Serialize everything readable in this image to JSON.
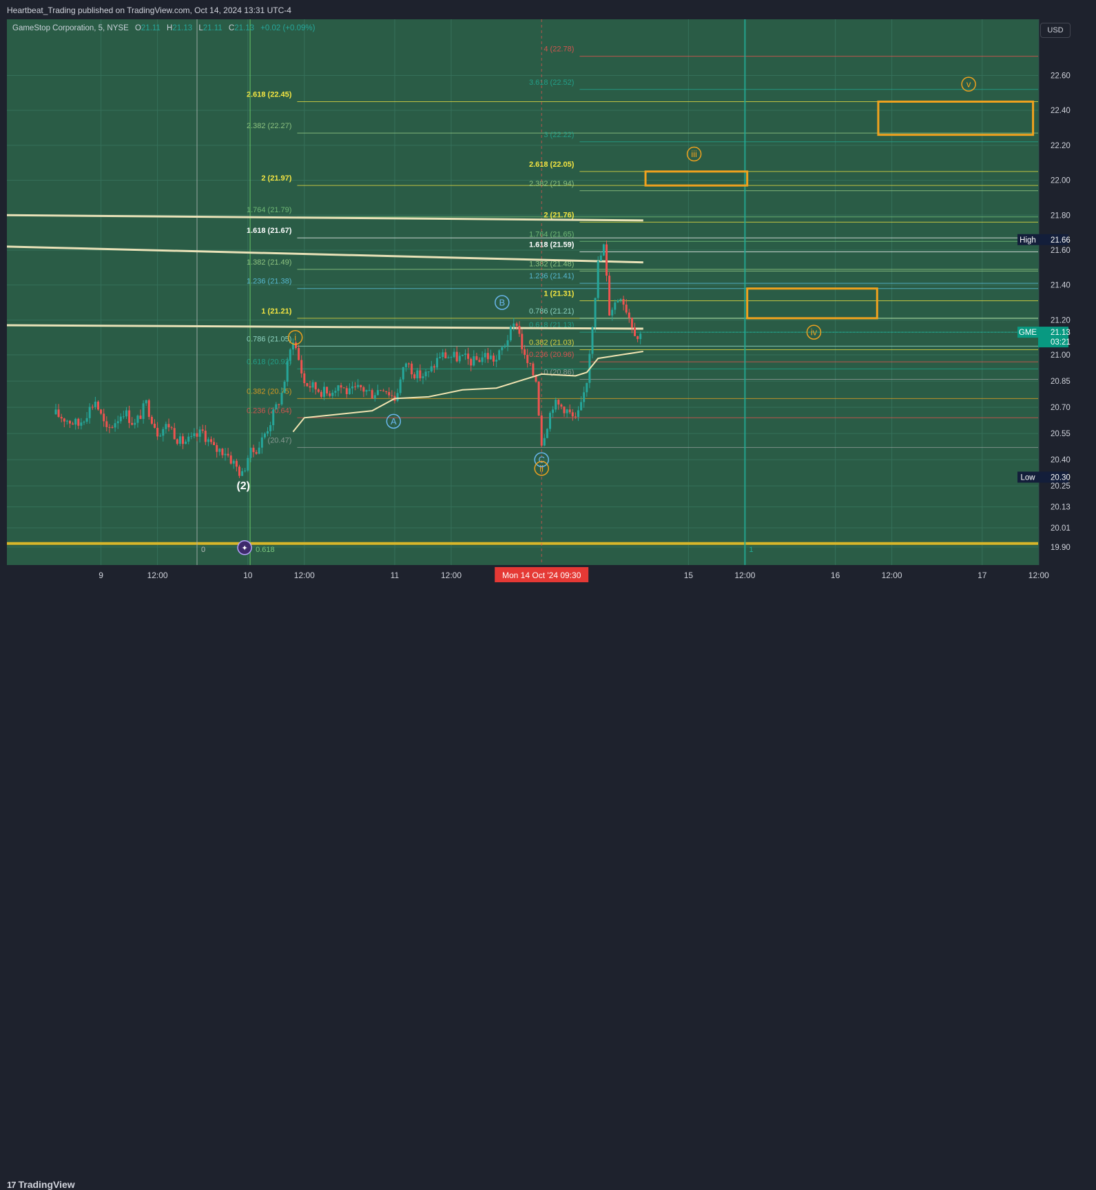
{
  "publish_line": "Heartbeat_Trading published on TradingView.com, Oct 14, 2024 13:31 UTC-4",
  "legend": {
    "symbol": "GameStop Corporation, 5, NYSE",
    "o_label": "O",
    "o_value": "21.11",
    "h_label": "H",
    "h_value": "21.13",
    "l_label": "L",
    "l_value": "21.11",
    "c_label": "C",
    "c_value": "21.13",
    "change": "+0.02 (+0.09%)"
  },
  "currency_button": "USD",
  "footer": {
    "logo_mark": "17",
    "logo_text": "TradingView"
  },
  "colors": {
    "background": "#2a5c46",
    "up": "#26a69a",
    "down": "#ef5350",
    "fib_yellow": "#f5e642",
    "orange": "#f0a21e",
    "teal": "#22ab94",
    "cream": "#f2e5b2"
  },
  "chart_data": {
    "type": "candlestick",
    "symbol": "GME",
    "y_range": [
      19.86,
      22.74
    ],
    "price_ticks": [
      "22.60",
      "22.40",
      "22.20",
      "22.00",
      "21.80",
      "21.60",
      "21.40",
      "21.20",
      "21.00",
      "20.85",
      "20.70",
      "20.55",
      "20.40",
      "20.25",
      "20.13",
      "20.01",
      "19.90"
    ],
    "time_ticks": [
      {
        "t": 4,
        "label": "9"
      },
      {
        "t": 9,
        "label": "12:00"
      },
      {
        "t": 17,
        "label": "10"
      },
      {
        "t": 22,
        "label": "12:00"
      },
      {
        "t": 30,
        "label": "11"
      },
      {
        "t": 35,
        "label": "12:00"
      },
      {
        "t": 56,
        "label": "15"
      },
      {
        "t": 61,
        "label": "12:00"
      },
      {
        "t": 69,
        "label": "16"
      },
      {
        "t": 74,
        "label": "12:00"
      },
      {
        "t": 82,
        "label": "17"
      },
      {
        "t": 87,
        "label": "12:00"
      }
    ],
    "crosshair_time_label": "Mon 14 Oct '24   09:30",
    "crosshair_t": 43,
    "current_price": {
      "symbol": "GME",
      "value": "21.13",
      "countdown": "03:21",
      "price": 21.13
    },
    "high_marker": {
      "label": "High",
      "value": "21.66",
      "price": 21.66
    },
    "low_marker": {
      "label": "Low",
      "value": "20.30",
      "price": 20.3
    },
    "price_path": [
      [
        0,
        20.66
      ],
      [
        2,
        20.6
      ],
      [
        3.5,
        20.74
      ],
      [
        4.5,
        20.56
      ],
      [
        6,
        20.68
      ],
      [
        7,
        20.6
      ],
      [
        8,
        20.72
      ],
      [
        9,
        20.56
      ],
      [
        10,
        20.6
      ],
      [
        11,
        20.5
      ],
      [
        12,
        20.51
      ],
      [
        13,
        20.56
      ],
      [
        14,
        20.46
      ],
      [
        15,
        20.45
      ],
      [
        16.5,
        20.31
      ],
      [
        17,
        20.42
      ],
      [
        18,
        20.48
      ],
      [
        19,
        20.62
      ],
      [
        20,
        20.78
      ],
      [
        21,
        21.1
      ],
      [
        22,
        20.84
      ],
      [
        23,
        20.81
      ],
      [
        24,
        20.78
      ],
      [
        25,
        20.83
      ],
      [
        26,
        20.78
      ],
      [
        27,
        20.81
      ],
      [
        28,
        20.78
      ],
      [
        29,
        20.82
      ],
      [
        30,
        20.75
      ],
      [
        31,
        20.96
      ],
      [
        32,
        20.88
      ],
      [
        33,
        20.89
      ],
      [
        34,
        21.0
      ],
      [
        35,
        20.99
      ],
      [
        36,
        20.98
      ],
      [
        37,
        20.96
      ],
      [
        38,
        21.0
      ],
      [
        39,
        20.97
      ],
      [
        40,
        21.1
      ],
      [
        40.8,
        21.19
      ],
      [
        41.5,
        20.98
      ],
      [
        42.5,
        20.86
      ],
      [
        43,
        20.5
      ],
      [
        44,
        20.72
      ],
      [
        45,
        20.7
      ],
      [
        46,
        20.62
      ],
      [
        46.5,
        20.7
      ],
      [
        47,
        20.86
      ],
      [
        48,
        21.52
      ],
      [
        48.5,
        21.62
      ],
      [
        49,
        21.25
      ],
      [
        50,
        21.35
      ],
      [
        51,
        21.18
      ],
      [
        51.5,
        21.1
      ],
      [
        52,
        21.13
      ]
    ],
    "vwap_bands": [
      {
        "t0": 0,
        "t1": 52,
        "p0": 21.8,
        "p1": 21.77
      },
      {
        "t0": 0,
        "t1": 52,
        "p0": 21.62,
        "p1": 21.53
      },
      {
        "t0": 0,
        "t1": 52,
        "p0": 21.17,
        "p1": 21.15
      }
    ],
    "anchored_vwap": [
      [
        21,
        20.56
      ],
      [
        22,
        20.64
      ],
      [
        25,
        20.66
      ],
      [
        28,
        20.68
      ],
      [
        30,
        20.75
      ],
      [
        33,
        20.76
      ],
      [
        36,
        20.8
      ],
      [
        39,
        20.81
      ],
      [
        41,
        20.85
      ],
      [
        43,
        20.89
      ],
      [
        46,
        20.88
      ],
      [
        47,
        20.9
      ],
      [
        48,
        20.98
      ],
      [
        50,
        21.0
      ],
      [
        52,
        21.02
      ]
    ],
    "fib_levels": [
      {
        "label": "2.618 (22.45)",
        "price": 22.45,
        "t0": 21,
        "t1": 93,
        "color": "#f5e642",
        "bold": true
      },
      {
        "label": "2.382 (22.27)",
        "price": 22.27,
        "t0": 21,
        "t1": 93,
        "color": "#9ed48a",
        "bold": false
      },
      {
        "label": "2 (21.97)",
        "price": 21.97,
        "t0": 21,
        "t1": 93,
        "color": "#f5e642",
        "bold": true
      },
      {
        "label": "1.764 (21.79)",
        "price": 21.79,
        "t0": 21,
        "t1": 93,
        "color": "#7cc97e",
        "bold": false
      },
      {
        "label": "1.618 (21.67)",
        "price": 21.67,
        "t0": 21,
        "t1": 93,
        "color": "#ffffff",
        "bold": true
      },
      {
        "label": "1.382 (21.49)",
        "price": 21.49,
        "t0": 21,
        "t1": 93,
        "color": "#9ed48a",
        "bold": false
      },
      {
        "label": "1.236 (21.38)",
        "price": 21.38,
        "t0": 21,
        "t1": 93,
        "color": "#5ec8e8",
        "bold": false
      },
      {
        "label": "1 (21.21)",
        "price": 21.21,
        "t0": 21,
        "t1": 93,
        "color": "#f5e642",
        "bold": true
      },
      {
        "label": "0.786 (21.05)",
        "price": 21.05,
        "t0": 21,
        "t1": 93,
        "color": "#9ee6d4",
        "bold": false
      },
      {
        "label": "0.618 (20.92)",
        "price": 20.92,
        "t0": 21,
        "t1": 93,
        "color": "#22ab94",
        "bold": false
      },
      {
        "label": "0.382 (20.75)",
        "price": 20.75,
        "t0": 21,
        "t1": 93,
        "color": "#f0a21e",
        "bold": false
      },
      {
        "label": "0.236 (20.64)",
        "price": 20.64,
        "t0": 21,
        "t1": 93,
        "color": "#ef5350",
        "bold": false
      },
      {
        "label": "(20.47)",
        "price": 20.47,
        "t0": 21,
        "t1": 93,
        "color": "#9aa3a0",
        "bold": false
      },
      {
        "label": "4 (22.78)",
        "price": 22.71,
        "t0": 46,
        "t1": 93,
        "color": "#ef5350",
        "bold": false
      },
      {
        "label": "3.618 (22.52)",
        "price": 22.52,
        "t0": 46,
        "t1": 93,
        "color": "#22ab94",
        "bold": false
      },
      {
        "label": "3 (22.22)",
        "price": 22.22,
        "t0": 46,
        "t1": 93,
        "color": "#22ab94",
        "bold": false
      },
      {
        "label": "2.618 (22.05)",
        "price": 22.05,
        "t0": 46,
        "t1": 93,
        "color": "#f5e642",
        "bold": true
      },
      {
        "label": "2.382 (21.94)",
        "price": 21.94,
        "t0": 46,
        "t1": 93,
        "color": "#9ed48a",
        "bold": false
      },
      {
        "label": "2 (21.76)",
        "price": 21.76,
        "t0": 46,
        "t1": 93,
        "color": "#f5e642",
        "bold": true
      },
      {
        "label": "1.764 (21.65)",
        "price": 21.65,
        "t0": 46,
        "t1": 93,
        "color": "#7cc97e",
        "bold": false
      },
      {
        "label": "1.618 (21.59)",
        "price": 21.59,
        "t0": 46,
        "t1": 93,
        "color": "#ffffff",
        "bold": true
      },
      {
        "label": "1.382 (21.48)",
        "price": 21.48,
        "t0": 46,
        "t1": 93,
        "color": "#9ed48a",
        "bold": false
      },
      {
        "label": "1.236 (21.41)",
        "price": 21.41,
        "t0": 46,
        "t1": 93,
        "color": "#5ec8e8",
        "bold": false
      },
      {
        "label": "1 (21.31)",
        "price": 21.31,
        "t0": 46,
        "t1": 93,
        "color": "#f5e642",
        "bold": true
      },
      {
        "label": "0.786 (21.21)",
        "price": 21.21,
        "t0": 46,
        "t1": 93,
        "color": "#9ee6d4",
        "bold": false
      },
      {
        "label": "0.618 (21.13)",
        "price": 21.13,
        "t0": 46,
        "t1": 93,
        "color": "#22ab94",
        "bold": false
      },
      {
        "label": "0.382 (21.03)",
        "price": 21.03,
        "t0": 46,
        "t1": 93,
        "color": "#f5e642",
        "bold": false
      },
      {
        "label": "0.236 (20.96)",
        "price": 20.96,
        "t0": 46,
        "t1": 93,
        "color": "#ef5350",
        "bold": false
      },
      {
        "label": "0 (20.86)",
        "price": 20.86,
        "t0": 46,
        "t1": 93,
        "color": "#9aa3a0",
        "bold": false
      }
    ],
    "base_fib": {
      "label": "0",
      "ratio": "0.618",
      "price": 19.92
    },
    "target_boxes": [
      {
        "label": "iii-target-box",
        "t0": 52.2,
        "t1": 61.2,
        "p_top": 22.05,
        "p_bot": 21.97
      },
      {
        "label": "v-target-box",
        "t0": 72.8,
        "t1": 86.5,
        "p_top": 22.45,
        "p_bot": 22.26
      },
      {
        "label": "iv-target-box",
        "t0": 61.2,
        "t1": 72.7,
        "p_top": 21.38,
        "p_bot": 21.21
      }
    ],
    "wave_labels": [
      {
        "text": "(2)",
        "t": 16.6,
        "p": 20.25,
        "style": "plain"
      },
      {
        "text": "i",
        "t": 21.2,
        "p": 21.1,
        "style": "orange-circle"
      },
      {
        "text": "A",
        "t": 29.9,
        "p": 20.62,
        "style": "blue-circle"
      },
      {
        "text": "B",
        "t": 39.5,
        "p": 21.3,
        "style": "blue-circle"
      },
      {
        "text": "C",
        "t": 43.0,
        "p": 20.4,
        "style": "blue-circle"
      },
      {
        "text": "ii",
        "t": 43.0,
        "p": 20.35,
        "style": "orange-circle"
      },
      {
        "text": "iii",
        "t": 56.5,
        "p": 22.15,
        "style": "orange-circle"
      },
      {
        "text": "iv",
        "t": 67.1,
        "p": 21.13,
        "style": "orange-circle"
      },
      {
        "text": "v",
        "t": 80.8,
        "p": 22.55,
        "style": "orange-circle"
      }
    ],
    "vertical_markers": [
      {
        "t": 12.5,
        "color": "#a8b0ad",
        "label": "0"
      },
      {
        "t": 17.2,
        "color": "#6fd36a",
        "label": ""
      },
      {
        "t": 61.0,
        "color": "#22ab94",
        "label": "1"
      }
    ]
  }
}
